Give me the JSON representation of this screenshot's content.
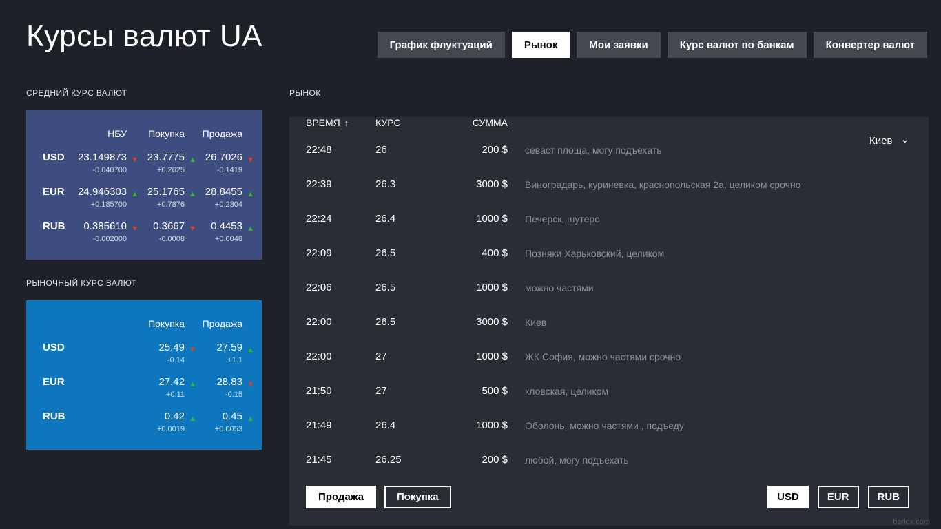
{
  "app": {
    "title": "Курсы валют UA",
    "watermark": "berlox.com"
  },
  "colors": {
    "page_bg": "#1e2228",
    "avg_panel": "#3e4d80",
    "market_rates_panel": "#0e76bc",
    "market_panel": "#2a2e34",
    "tab_bg": "#45494f",
    "up": "#2fb52f",
    "down": "#e23b2c"
  },
  "icons": {
    "chevron_down": "⌄",
    "sort_asc": "↑",
    "trend_up": "▲",
    "trend_down": "▼"
  },
  "tabs": [
    {
      "label": "График флуктуаций",
      "active": false
    },
    {
      "label": "Рынок",
      "active": true
    },
    {
      "label": "Мои заявки",
      "active": false
    },
    {
      "label": "Курс валют по банкам",
      "active": false
    },
    {
      "label": "Конвертер валют",
      "active": false
    }
  ],
  "average_rates": {
    "section_title": "СРЕДНИЙ КУРС ВАЛЮТ",
    "columns": [
      "НБУ",
      "Покупка",
      "Продажа"
    ],
    "rows": [
      {
        "currency": "USD",
        "cells": [
          {
            "value": "23.149873",
            "delta": "-0.040700",
            "dir": "down"
          },
          {
            "value": "23.7775",
            "delta": "+0.2625",
            "dir": "up"
          },
          {
            "value": "26.7026",
            "delta": "-0.1419",
            "dir": "down"
          }
        ]
      },
      {
        "currency": "EUR",
        "cells": [
          {
            "value": "24.946303",
            "delta": "+0.185700",
            "dir": "up"
          },
          {
            "value": "25.1765",
            "delta": "+0.7876",
            "dir": "up"
          },
          {
            "value": "28.8455",
            "delta": "+0.2304",
            "dir": "up"
          }
        ]
      },
      {
        "currency": "RUB",
        "cells": [
          {
            "value": "0.385610",
            "delta": "-0.002000",
            "dir": "down"
          },
          {
            "value": "0.3667",
            "delta": "-0.0008",
            "dir": "down"
          },
          {
            "value": "0.4453",
            "delta": "+0.0048",
            "dir": "up"
          }
        ]
      }
    ]
  },
  "market_rates": {
    "section_title": "РЫНОЧНЫЙ КУРС ВАЛЮТ",
    "columns": [
      "Покупка",
      "Продажа"
    ],
    "rows": [
      {
        "currency": "USD",
        "cells": [
          {
            "value": "25.49",
            "delta": "-0.14",
            "dir": "down"
          },
          {
            "value": "27.59",
            "delta": "+1.1",
            "dir": "up"
          }
        ]
      },
      {
        "currency": "EUR",
        "cells": [
          {
            "value": "27.42",
            "delta": "+0.11",
            "dir": "up"
          },
          {
            "value": "28.83",
            "delta": "-0.15",
            "dir": "down"
          }
        ]
      },
      {
        "currency": "RUB",
        "cells": [
          {
            "value": "0.42",
            "delta": "+0.0019",
            "dir": "up"
          },
          {
            "value": "0.45",
            "delta": "+0.0053",
            "dir": "up"
          }
        ]
      }
    ]
  },
  "market": {
    "section_title": "РЫНОК",
    "columns": {
      "time": "ВРЕМЯ",
      "rate": "КУРС",
      "amount": "СУММА"
    },
    "city_filter": "Киев",
    "rows": [
      {
        "time": "22:48",
        "rate": "26",
        "amount": "200 $",
        "comment": "севаст площа, могу подъехать"
      },
      {
        "time": "22:39",
        "rate": "26.3",
        "amount": "3000 $",
        "comment": "Виноградарь, куриневка, краснопольская 2а, целиком срочно"
      },
      {
        "time": "22:24",
        "rate": "26.4",
        "amount": "1000 $",
        "comment": "Печерск, шутерс"
      },
      {
        "time": "22:09",
        "rate": "26.5",
        "amount": "400 $",
        "comment": "Позняки Харьковский, целиком"
      },
      {
        "time": "22:06",
        "rate": "26.5",
        "amount": "1000 $",
        "comment": "можно частями"
      },
      {
        "time": "22:00",
        "rate": "26.5",
        "amount": "3000 $",
        "comment": "Киев"
      },
      {
        "time": "22:00",
        "rate": "27",
        "amount": "1000 $",
        "comment": "ЖК София, можно частями срочно"
      },
      {
        "time": "21:50",
        "rate": "27",
        "amount": "500 $",
        "comment": "кловская, целиком"
      },
      {
        "time": "21:49",
        "rate": "26.4",
        "amount": "1000 $",
        "comment": "Оболонь, можно частями , подъеду"
      },
      {
        "time": "21:45",
        "rate": "26.25",
        "amount": "200 $",
        "comment": "любой, могу подъехать"
      }
    ],
    "mode_buttons": [
      {
        "label": "Продажа",
        "active": true
      },
      {
        "label": "Покупка",
        "active": false
      }
    ],
    "currency_buttons": [
      {
        "label": "USD",
        "active": true
      },
      {
        "label": "EUR",
        "active": false
      },
      {
        "label": "RUB",
        "active": false
      }
    ]
  }
}
